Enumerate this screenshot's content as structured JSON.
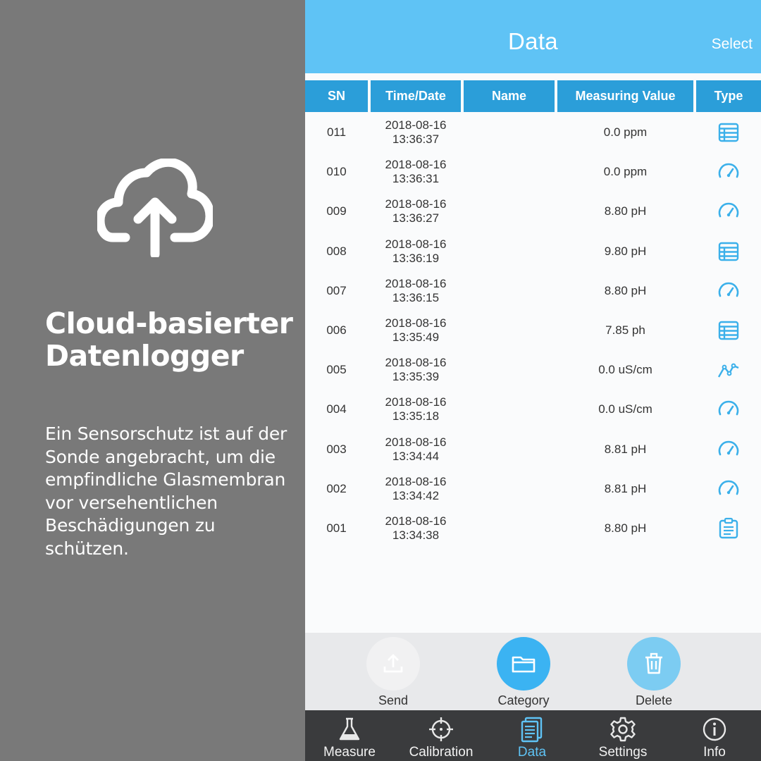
{
  "promo": {
    "title_line1": "Cloud-basierter",
    "title_line2": "Datenlogger",
    "body": "Ein Sensorschutz ist auf der Sonde angebracht, um die empfindliche Glasmembran vor versehentlichen Beschädigungen zu schützen.",
    "icon": "cloud-upload-icon"
  },
  "header": {
    "title": "Data",
    "select_label": "Select"
  },
  "table": {
    "columns": [
      "SN",
      "Time/Date",
      "Name",
      "Measuring Value",
      "Type"
    ],
    "rows": [
      {
        "sn": "011",
        "date": "2018-08-16",
        "time": "13:36:37",
        "name": "",
        "value": "0.0 ppm",
        "type": "table-icon"
      },
      {
        "sn": "010",
        "date": "2018-08-16",
        "time": "13:36:31",
        "name": "",
        "value": "0.0 ppm",
        "type": "gauge-icon"
      },
      {
        "sn": "009",
        "date": "2018-08-16",
        "time": "13:36:27",
        "name": "",
        "value": "8.80 pH",
        "type": "gauge-icon"
      },
      {
        "sn": "008",
        "date": "2018-08-16",
        "time": "13:36:19",
        "name": "",
        "value": "9.80 pH",
        "type": "table-icon"
      },
      {
        "sn": "007",
        "date": "2018-08-16",
        "time": "13:36:15",
        "name": "",
        "value": "8.80 pH",
        "type": "gauge-icon"
      },
      {
        "sn": "006",
        "date": "2018-08-16",
        "time": "13:35:49",
        "name": "",
        "value": "7.85 ph",
        "type": "table-icon"
      },
      {
        "sn": "005",
        "date": "2018-08-16",
        "time": "13:35:39",
        "name": "",
        "value": "0.0 uS/cm",
        "type": "line-chart-icon"
      },
      {
        "sn": "004",
        "date": "2018-08-16",
        "time": "13:35:18",
        "name": "",
        "value": "0.0 uS/cm",
        "type": "gauge-icon"
      },
      {
        "sn": "003",
        "date": "2018-08-16",
        "time": "13:34:44",
        "name": "",
        "value": "8.81 pH",
        "type": "gauge-icon"
      },
      {
        "sn": "002",
        "date": "2018-08-16",
        "time": "13:34:42",
        "name": "",
        "value": "8.81 pH",
        "type": "gauge-icon"
      },
      {
        "sn": "001",
        "date": "2018-08-16",
        "time": "13:34:38",
        "name": "",
        "value": "8.80 pH",
        "type": "clipboard-icon"
      }
    ]
  },
  "actions": [
    {
      "label": "Send",
      "icon": "upload-icon",
      "color": "#f1f1f2"
    },
    {
      "label": "Category",
      "icon": "folder-icon",
      "color": "#3bb3f2"
    },
    {
      "label": "Delete",
      "icon": "trash-icon",
      "color": "#7cccf2"
    }
  ],
  "tabs": [
    {
      "label": "Measure",
      "icon": "flask-icon",
      "active": false
    },
    {
      "label": "Calibration",
      "icon": "crosshair-icon",
      "active": false
    },
    {
      "label": "Data",
      "icon": "document-icon",
      "active": true
    },
    {
      "label": "Settings",
      "icon": "gear-icon",
      "active": false
    },
    {
      "label": "Info",
      "icon": "info-icon",
      "active": false
    }
  ],
  "colors": {
    "accent": "#5fc3f5",
    "table_header": "#2b9ed9",
    "tab_bar": "#3a3b3d",
    "icon_blue": "#3bb0ea"
  }
}
